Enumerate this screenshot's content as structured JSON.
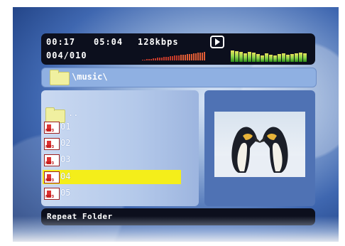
{
  "player": {
    "elapsed": "00:17",
    "total": "05:04",
    "bitrate": "128kbps",
    "track_counter": "004/010"
  },
  "path": "\\music\\",
  "file_list": {
    "parent": "..",
    "items": [
      "01",
      "02",
      "03",
      "04",
      "05"
    ],
    "selected": "04"
  },
  "footer": "Repeat Folder",
  "colors": {
    "selection": "#f4ee1a",
    "panel_dark": "#0c0f1d",
    "eq_green": "#8fd54a"
  },
  "icons": [
    "play-icon",
    "folder-icon",
    "mp3-file-icon",
    "scroll-up-icon",
    "scroll-down-icon"
  ]
}
